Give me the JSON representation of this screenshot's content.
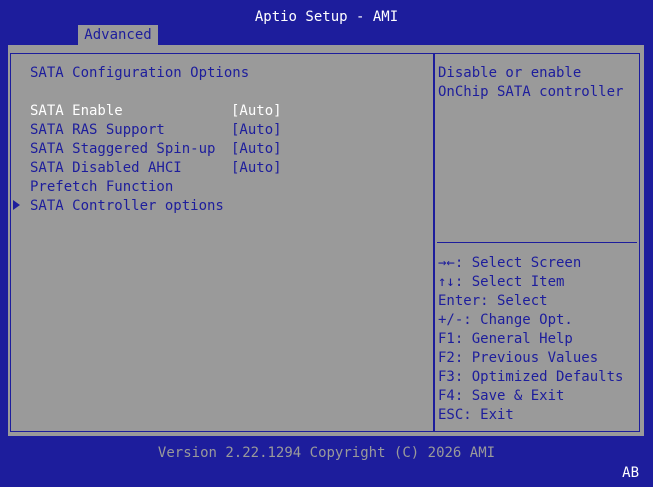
{
  "header": {
    "title": "Aptio Setup - AMI",
    "tab": "Advanced"
  },
  "main": {
    "section_title": "SATA Configuration Options",
    "settings": [
      {
        "label": "SATA Enable",
        "value": "[Auto]"
      },
      {
        "label": "SATA RAS Support",
        "value": "[Auto]"
      },
      {
        "label": "SATA Staggered Spin-up",
        "value": "[Auto]"
      },
      {
        "label": "SATA Disabled AHCI",
        "value": "[Auto]"
      }
    ],
    "prefetch_label": "Prefetch Function",
    "submenu_label": "SATA Controller options",
    "submenu_icon": "triangle-right-icon"
  },
  "help": {
    "description_line1": "Disable or enable",
    "description_line2": "OnChip SATA controller",
    "keys": [
      "→←: Select Screen",
      "↑↓: Select Item",
      "Enter: Select",
      "+/-: Change Opt.",
      "F1: General Help",
      "F2: Previous Values",
      "F3: Optimized Defaults",
      "F4: Save & Exit",
      "ESC: Exit"
    ]
  },
  "footer": {
    "version": "Version 2.22.1294 Copyright (C) 2026 AMI",
    "corner": "AB"
  },
  "colors": {
    "frame_blue": "#1d1d9c",
    "panel_gray": "#9a9a9a",
    "highlight_white": "#ffffff"
  }
}
